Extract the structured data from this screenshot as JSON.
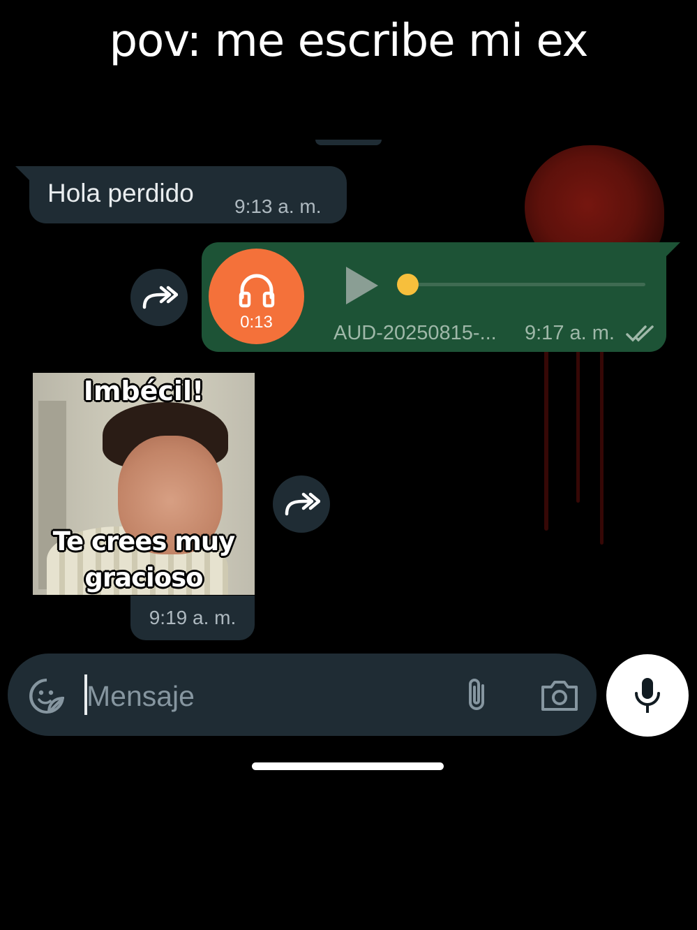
{
  "caption": "pov: me escribe mi ex",
  "messages": {
    "incoming_text": {
      "text": "Hola perdido",
      "time": "9:13 a. m."
    },
    "audio": {
      "duration": "0:13",
      "filename": "AUD-20250815-...",
      "time": "9:17 a. m.",
      "progress": 0,
      "status": "read",
      "icon": "headphones-icon"
    },
    "sticker": {
      "top_text": "Imbécil!",
      "bottom_text_line1": "Te crees muy",
      "bottom_text_line2": "gracioso",
      "time": "9:19 a. m."
    }
  },
  "input": {
    "placeholder": "Mensaje",
    "icons": [
      "sticker-icon",
      "attach-icon",
      "camera-icon",
      "mic-icon"
    ]
  },
  "colors": {
    "incoming_bubble": "#1f2c34",
    "outgoing_bubble": "#1d5336",
    "audio_avatar": "#f4713a",
    "audio_thumb": "#f7bf3c",
    "background": "#000000"
  }
}
